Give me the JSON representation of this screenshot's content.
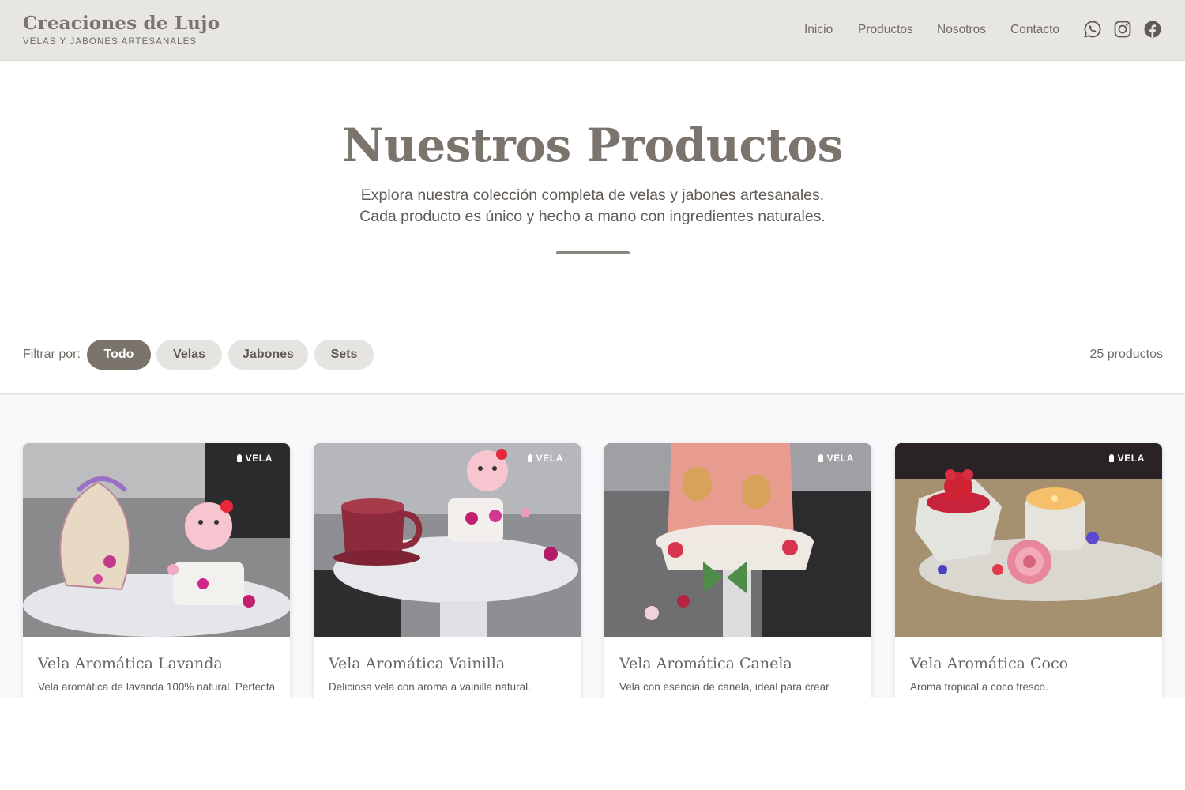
{
  "brand": {
    "title": "Creaciones de Lujo",
    "subtitle": "VELAS Y JABONES ARTESANALES"
  },
  "nav": {
    "items": [
      "Inicio",
      "Productos",
      "Nosotros",
      "Contacto"
    ]
  },
  "social": [
    "whatsapp-icon",
    "instagram-icon",
    "facebook-icon"
  ],
  "hero": {
    "title": "Nuestros Productos",
    "description": "Explora nuestra colección completa de velas y jabones artesanales. Cada producto es único y hecho a mano con ingredientes naturales."
  },
  "filter": {
    "label": "Filtrar por:",
    "options": [
      "Todo",
      "Velas",
      "Jabones",
      "Sets"
    ],
    "active": "Todo",
    "count_text": "25 productos"
  },
  "products": [
    {
      "badge": "VELA",
      "title": "Vela Aromática Lavanda",
      "description": "Vela aromática de lavanda 100% natural. Perfecta"
    },
    {
      "badge": "VELA",
      "title": "Vela Aromática Vainilla",
      "description": "Deliciosa vela con aroma a vainilla natural."
    },
    {
      "badge": "VELA",
      "title": "Vela Aromática Canela",
      "description": "Vela con esencia de canela, ideal para crear"
    },
    {
      "badge": "VELA",
      "title": "Vela Aromática Coco",
      "description": "Aroma tropical a coco fresco."
    }
  ],
  "colors": {
    "header_bg": "#e8e6e3",
    "accent": "#7a746d",
    "pill_bg": "#e6e4e1"
  }
}
